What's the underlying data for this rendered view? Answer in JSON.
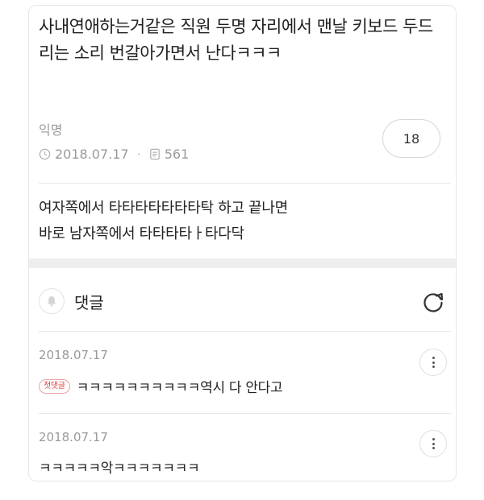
{
  "post": {
    "title": "사내연애하는거같은 직원 두명 자리에서 맨날 키보드 두드리는 소리 번갈아가면서 난다ㅋㅋㅋ",
    "author": "익명",
    "date": "2018.07.17",
    "views": "561",
    "comment_count": "18",
    "body_line1": "여자쪽에서 타타타타타타타탁 하고 끝나면",
    "body_line2": "바로 남자쪽에서 타타타타ㅏ타다닥"
  },
  "comments_section": {
    "label": "댓글",
    "bell_icon": "bell-icon",
    "refresh_icon": "refresh-icon"
  },
  "comments": [
    {
      "date": "2018.07.17",
      "badge": "첫댓글",
      "text": "ㅋㅋㅋㅋㅋㅋㅋㅋㅋㅋ역시 다 안다고"
    },
    {
      "date": "2018.07.17",
      "text": "ㅋㅋㅋㅋㅋ악ㅋㅋㅋㅋㅋㅋㅋ"
    }
  ]
}
